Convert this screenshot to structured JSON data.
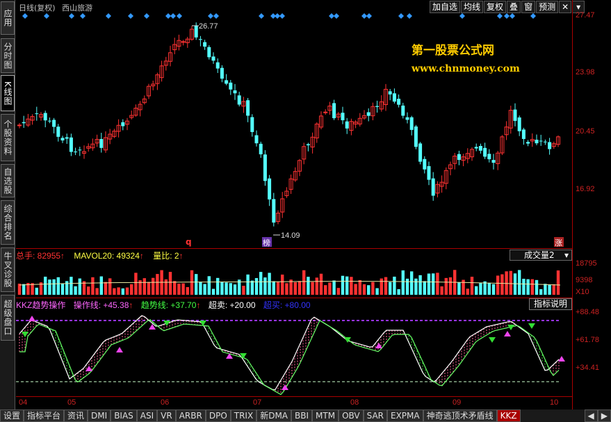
{
  "left_tabs": [
    {
      "label": "应用",
      "name": "tab-apps"
    },
    {
      "label": "分时图",
      "name": "tab-intraday"
    },
    {
      "label": "K线图",
      "name": "tab-kline",
      "active": true
    },
    {
      "label": "个股资料",
      "name": "tab-stock-info"
    },
    {
      "label": "自选股",
      "name": "tab-watchlist"
    },
    {
      "label": "综合排名",
      "name": "tab-ranking"
    },
    {
      "label": "牛叉诊股",
      "name": "tab-diagnosis"
    },
    {
      "label": "超级盘口",
      "name": "tab-super-board"
    }
  ],
  "header": {
    "period": "日线(复权)",
    "stock_name": "西山旅游"
  },
  "toolbar": [
    {
      "label": "加自选",
      "name": "add-watchlist-button"
    },
    {
      "label": "均线",
      "name": "moving-average-button"
    },
    {
      "label": "复权",
      "name": "adjust-button"
    },
    {
      "label": "叠",
      "name": "overlay-button"
    },
    {
      "label": "窗",
      "name": "window-button"
    },
    {
      "label": "预测",
      "name": "forecast-button"
    }
  ],
  "watermark": {
    "line1": "第一股票公式网",
    "line2": "www.chnmoney.com"
  },
  "price_axis": [
    "27.47",
    "23.98",
    "20.45",
    "16.92"
  ],
  "annotations": {
    "high": "26.77",
    "low": "14.09",
    "marker_q": "q",
    "marker_bang": "榜",
    "marker_zhang": "涨"
  },
  "volume_panel": {
    "total_label": "总手: 82955",
    "mavol_label": "MAVOL20: 49324",
    "ratio_label": "量比: 2",
    "selector_value": "成交量2",
    "axis": [
      "18795",
      "9398",
      "X10"
    ]
  },
  "indicator_panel": {
    "title": "KKZ趋势操作",
    "op_line": "操作线: +45.38",
    "trend_line": "趋势线: +37.70",
    "overbought": "超卖: +20.00",
    "oversold": "超买: +80.00",
    "help_button": "指标说明",
    "axis": [
      "+88.48",
      "+61.78",
      "+34.41"
    ]
  },
  "x_axis": [
    "04",
    "05",
    "06",
    "07",
    "08",
    "09",
    "10"
  ],
  "bottom_tabs": [
    "设置",
    "指标平台",
    "资讯",
    "DMI",
    "BIAS",
    "ASI",
    "VR",
    "ARBR",
    "DPO",
    "TRIX",
    "新DMA",
    "BBI",
    "MTM",
    "OBV",
    "SAR",
    "EXPMA",
    "神奇逃顶术矛盾线",
    "KKZ"
  ],
  "colors": {
    "up": "#ff3232",
    "down": "#54ffff",
    "axis": "#cc2222",
    "accent": "#ffcc00",
    "purple": "#cc33cc",
    "green": "#33cc33"
  }
}
